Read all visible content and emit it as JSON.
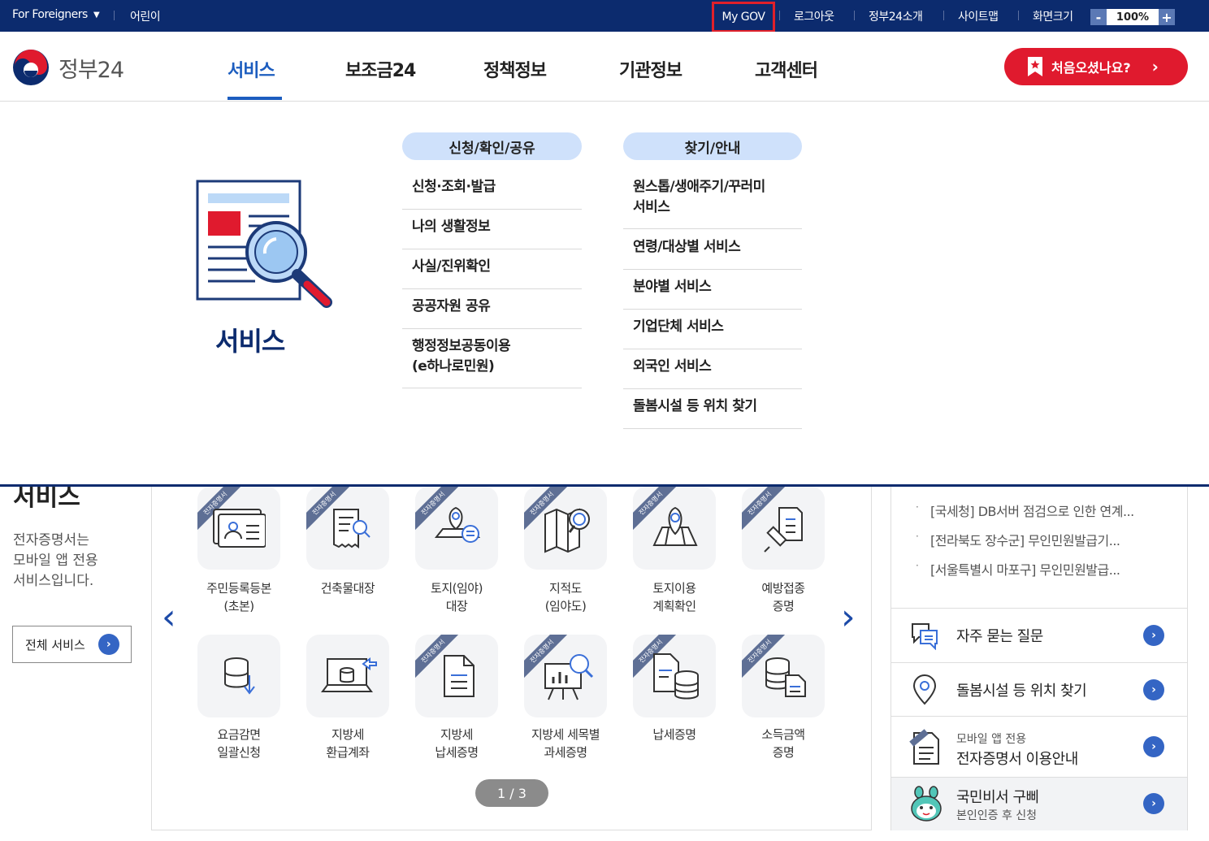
{
  "topbar": {
    "for_foreigners": "For Foreigners",
    "kids": "어린이",
    "mygov": "My GOV",
    "logout": "로그아웃",
    "intro": "정부24소개",
    "sitemap": "사이트맵",
    "zoom_label": "화면크기",
    "zoom_minus": "-",
    "zoom_value": "100%",
    "zoom_plus": "+"
  },
  "header": {
    "logo_text": "정부24",
    "nav": [
      "서비스",
      "보조금24",
      "정책정보",
      "기관정보",
      "고객센터"
    ],
    "first_visit": "처음오셨나요?"
  },
  "mega": {
    "title": "서비스",
    "col1": {
      "heading": "신청/확인/공유",
      "items": [
        "신청·조회·발급",
        "나의 생활정보",
        "사실/진위확인",
        "공공자원 공유",
        "행정정보공동이용",
        "(e하나로민원)"
      ]
    },
    "col2": {
      "heading": "찾기/안내",
      "items": [
        "원스톱/생애주기/꾸러미",
        "서비스",
        "연령/대상별 서비스",
        "분야별 서비스",
        "기업단체 서비스",
        "외국인 서비스",
        "돌봄시설 등 위치 찾기"
      ]
    }
  },
  "lower": {
    "partial_title": "서비스",
    "desc": [
      "전자증명서는",
      "모바일 앱 전용",
      "서비스입니다."
    ],
    "all_services": "전체 서비스",
    "ribbon": "전자증명서",
    "tiles": [
      {
        "l1": "주민등록등본",
        "l2": "(초본)",
        "icon": "id-card-icon"
      },
      {
        "l1": "건축물대장",
        "l2": "",
        "icon": "document-search-icon"
      },
      {
        "l1": "토지(임야)",
        "l2": "대장",
        "icon": "land-pin-icon"
      },
      {
        "l1": "지적도",
        "l2": "(임야도)",
        "icon": "map-search-icon"
      },
      {
        "l1": "토지이용",
        "l2": "계획확인",
        "icon": "map-pin-icon"
      },
      {
        "l1": "예방접종",
        "l2": "증명",
        "icon": "syringe-icon"
      },
      {
        "l1": "요금감면",
        "l2": "일괄신청",
        "icon": "database-down-icon"
      },
      {
        "l1": "지방세",
        "l2": "환급계좌",
        "icon": "database-transfer-icon"
      },
      {
        "l1": "지방세",
        "l2": "납세증명",
        "icon": "document-icon"
      },
      {
        "l1": "지방세 세목별",
        "l2": "과세증명",
        "icon": "chart-search-icon"
      },
      {
        "l1": "납세증명",
        "l2": "",
        "icon": "document-database-icon"
      },
      {
        "l1": "소득금액",
        "l2": "증명",
        "icon": "database-document-icon"
      }
    ],
    "pager": "1 / 3",
    "prev": "‹",
    "next": "›"
  },
  "right": {
    "news": [
      "[국세청] DB서버 점검으로 인한 연계...",
      "[전라북도 장수군] 무인민원발급기...",
      "[서울특별시 마포구] 무인민원발급..."
    ],
    "faq": "자주 묻는 질문",
    "care": "돌봄시설 등 위치 찾기",
    "mobile_small": "모바일 앱 전용",
    "mobile_main": "전자증명서 이용안내",
    "bibi_main": "국민비서 구삐",
    "bibi_small": "본인인증 후 신청"
  }
}
